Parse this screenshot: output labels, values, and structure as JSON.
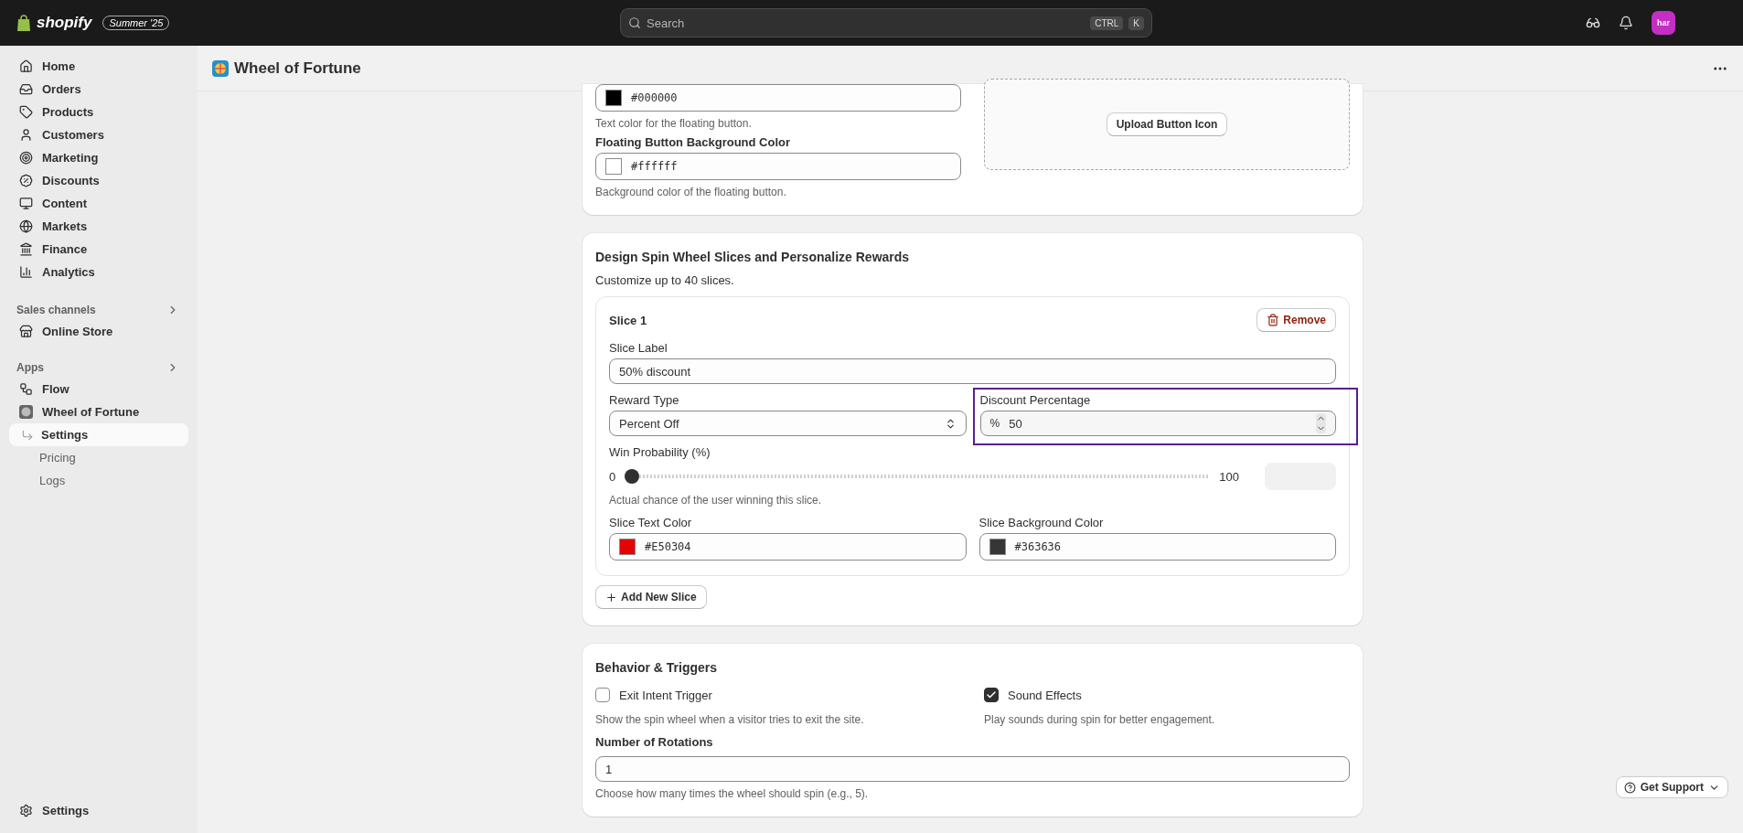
{
  "topbar": {
    "brand": "shopify",
    "badge": "Summer '25",
    "search": {
      "placeholder": "Search",
      "keys": [
        "CTRL",
        "K"
      ]
    },
    "avatar": "har"
  },
  "sidebar": {
    "items": [
      {
        "label": "Home",
        "selected": false
      },
      {
        "label": "Orders",
        "selected": false
      },
      {
        "label": "Products",
        "selected": false
      },
      {
        "label": "Customers",
        "selected": false
      },
      {
        "label": "Marketing",
        "selected": false
      },
      {
        "label": "Discounts",
        "selected": false
      },
      {
        "label": "Content",
        "selected": false
      },
      {
        "label": "Markets",
        "selected": false
      },
      {
        "label": "Finance",
        "selected": false
      },
      {
        "label": "Analytics",
        "selected": false
      }
    ],
    "sales_channels": {
      "title": "Sales channels",
      "items": [
        {
          "label": "Online Store",
          "selected": false
        }
      ]
    },
    "apps": {
      "title": "Apps",
      "items": [
        {
          "label": "Flow",
          "selected": false
        },
        {
          "label": "Wheel of Fortune",
          "selected": false,
          "children": [
            {
              "label": "Settings",
              "selected": true
            },
            {
              "label": "Pricing",
              "selected": false
            },
            {
              "label": "Logs",
              "selected": false
            }
          ]
        }
      ]
    },
    "footer": "Settings"
  },
  "page": {
    "title": "Wheel of Fortune"
  },
  "button_card": {
    "text_color": {
      "value": "#000000",
      "color": "#000000",
      "help": "Text color for the floating button."
    },
    "bg_color": {
      "label": "Floating Button Background Color",
      "value": "#ffffff",
      "color": "#ffffff",
      "help": "Background color of the floating button."
    },
    "upload_button": "Upload Button Icon"
  },
  "slices_card": {
    "title": "Design Spin Wheel Slices and Personalize Rewards",
    "subtitle": "Customize up to 40 slices.",
    "slices": [
      {
        "title": "Slice 1",
        "remove": "Remove",
        "label_field": {
          "label": "Slice Label",
          "value": "50% discount"
        },
        "reward_type": {
          "label": "Reward Type",
          "value": "Percent Off"
        },
        "discount": {
          "label": "Discount Percentage",
          "prefix": "%",
          "value": "50",
          "focused": true
        },
        "probability": {
          "label": "Win Probability (%)",
          "min": "0",
          "max": "100",
          "level": 0,
          "help": "Actual chance of the user winning this slice."
        },
        "colors": [
          {
            "label": "Slice Text Color",
            "value": "#E50304",
            "color": "#e50304"
          },
          {
            "label": "Slice Background Color",
            "value": "#363636",
            "color": "#363636"
          }
        ]
      }
    ],
    "add_button": "Add New Slice"
  },
  "behavior_card": {
    "title": "Behavior & Triggers",
    "options": [
      {
        "label": "Exit Intent Trigger",
        "checked": false,
        "help": "Show the spin wheel when a visitor tries to exit the site."
      },
      {
        "label": "Sound Effects",
        "checked": true,
        "help": "Play sounds during spin for better engagement."
      }
    ],
    "rotations": {
      "label": "Number of Rotations",
      "value": "1",
      "help": "Choose how many times the wheel should spin (e.g., 5)."
    }
  },
  "support_button": "Get Support"
}
